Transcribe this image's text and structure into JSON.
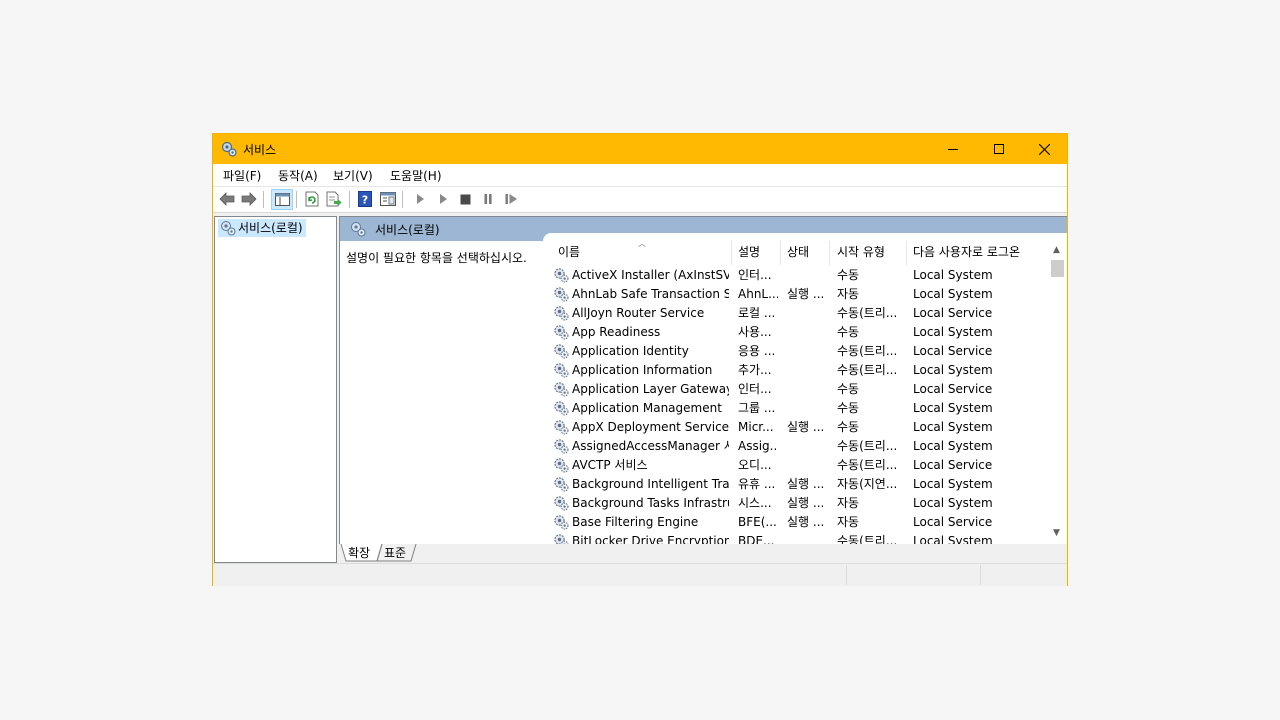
{
  "window": {
    "title": "서비스",
    "accent_color": "#ffb900",
    "controls": {
      "minimize_icon": "minimize-icon",
      "maximize_icon": "maximize-icon",
      "close_icon": "close-icon"
    }
  },
  "menu": {
    "items": [
      {
        "label": "파일(F)"
      },
      {
        "label": "동작(A)"
      },
      {
        "label": "보기(V)"
      },
      {
        "label": "도움말(H)"
      }
    ]
  },
  "toolbar": {
    "icons": [
      "back-arrow-icon",
      "forward-arrow-icon",
      "show-hide-tree-icon",
      "refresh-icon",
      "export-list-icon",
      "help-icon",
      "properties-icon",
      "start-service-icon",
      "start-service-alt-icon",
      "stop-service-icon",
      "pause-service-icon",
      "restart-service-icon"
    ]
  },
  "tree": {
    "items": [
      {
        "label": "서비스(로컬)"
      }
    ]
  },
  "main": {
    "header_title": "서비스(로컬)",
    "description_prompt": "설명이 필요한 항목을 선택하십시오.",
    "columns": [
      "이름",
      "설명",
      "상태",
      "시작 유형",
      "다음 사용자로 로그온"
    ],
    "rows": [
      {
        "name": "ActiveX Installer (AxInstSV)",
        "desc": "인터...",
        "status": "",
        "startup": "수동",
        "logon": "Local System"
      },
      {
        "name": "AhnLab Safe Transaction S...",
        "desc": "AhnL...",
        "status": "실행 ...",
        "startup": "자동",
        "logon": "Local System"
      },
      {
        "name": "AllJoyn Router Service",
        "desc": "로컬 ...",
        "status": "",
        "startup": "수동(트리...",
        "logon": "Local Service"
      },
      {
        "name": "App Readiness",
        "desc": "사용...",
        "status": "",
        "startup": "수동",
        "logon": "Local System"
      },
      {
        "name": "Application Identity",
        "desc": "응용 ...",
        "status": "",
        "startup": "수동(트리...",
        "logon": "Local Service"
      },
      {
        "name": "Application Information",
        "desc": "추가...",
        "status": "",
        "startup": "수동(트리...",
        "logon": "Local System"
      },
      {
        "name": "Application Layer Gateway ...",
        "desc": "인터...",
        "status": "",
        "startup": "수동",
        "logon": "Local Service"
      },
      {
        "name": "Application Management",
        "desc": "그룹 ...",
        "status": "",
        "startup": "수동",
        "logon": "Local System"
      },
      {
        "name": "AppX Deployment Service ...",
        "desc": "Micr...",
        "status": "실행 ...",
        "startup": "수동",
        "logon": "Local System"
      },
      {
        "name": "AssignedAccessManager 서...",
        "desc": "Assig...",
        "status": "",
        "startup": "수동(트리...",
        "logon": "Local System"
      },
      {
        "name": "AVCTP 서비스",
        "desc": "오디...",
        "status": "",
        "startup": "수동(트리...",
        "logon": "Local Service"
      },
      {
        "name": "Background Intelligent Tra...",
        "desc": "유휴 ...",
        "status": "실행 ...",
        "startup": "자동(지연...",
        "logon": "Local System"
      },
      {
        "name": "Background Tasks Infrastru...",
        "desc": "시스...",
        "status": "실행 ...",
        "startup": "자동",
        "logon": "Local System"
      },
      {
        "name": "Base Filtering Engine",
        "desc": "BFE(...",
        "status": "실행 ...",
        "startup": "자동",
        "logon": "Local Service"
      },
      {
        "name": "BitLocker Drive Encryption ...",
        "desc": "BDE...",
        "status": "",
        "startup": "수동(트리...",
        "logon": "Local System"
      }
    ]
  },
  "tabs": [
    {
      "label": "확장"
    },
    {
      "label": "표준"
    }
  ]
}
